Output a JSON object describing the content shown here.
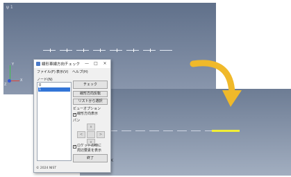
{
  "viewport_top": {
    "label": "ψ 1"
  },
  "axes": {
    "x": "X",
    "y": "Y",
    "z": "Z"
  },
  "viewport_bottom": {
    "label": "X"
  },
  "dialog": {
    "title": "線形車線方向チェック",
    "controls": {
      "minimize": "—",
      "maximize": "□",
      "close": "×"
    },
    "menu": [
      "ファイル(F)",
      "表示(V)",
      "ヘルプ(H)"
    ],
    "node_list_label": "ノード(N)",
    "node_items": [
      "0",
      "1"
    ],
    "selected_index": 1,
    "buttons": {
      "check": "チェック",
      "reverse": "線形方向反転",
      "apply_list": "リストから選択"
    },
    "view_option_label": "ビューオプション",
    "show_direction": {
      "label": "線形方向表示",
      "checked": true
    },
    "pan_label": "パン",
    "pan_buttons": {
      "up": "∧",
      "left": "<",
      "right": ">",
      "down": "∨"
    },
    "auto_option": {
      "line1": "ロケットの時に",
      "line2": "周辺要素を表示",
      "checked": true
    },
    "close_button": "終了",
    "footer": "© 2024 NIST"
  },
  "colors": {
    "arrow": "#f0b92a",
    "highlight": "#f2ee34",
    "selection": "#3375d7"
  }
}
